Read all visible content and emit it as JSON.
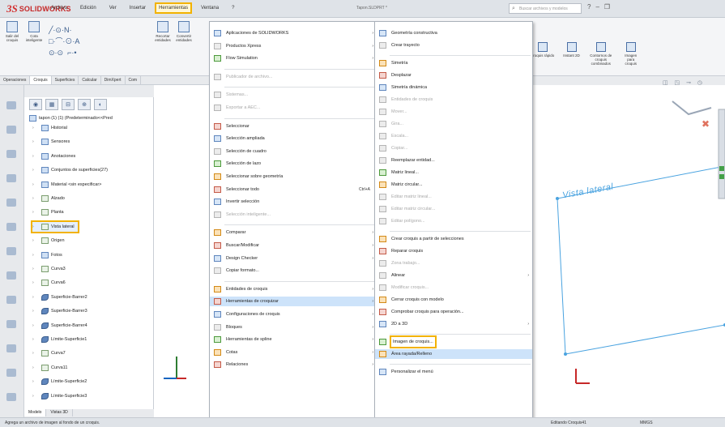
{
  "app": {
    "brand_ds": "3S",
    "brand_name": "SOLIDWORKS",
    "doc_title": "Tapon.SLDPRT *",
    "search_placeholder": "Buscar archivos y modelos"
  },
  "menubar": [
    "Archivo",
    "Edición",
    "Ver",
    "Insertar",
    "Herramientas",
    "Ventana",
    "?"
  ],
  "ribbon": {
    "left_buttons": [
      "Salir del croquis",
      "Cota inteligente",
      "Recortar entidades",
      "Convertir entidades"
    ],
    "right_buttons": [
      "Croquis rápido",
      "Instant 2D",
      "Contornos de croquis combinados",
      "Imagen para croquis"
    ]
  },
  "command_tabs": [
    "Operaciones",
    "Croquis",
    "Superficies",
    "Calcular",
    "DimXpert",
    "Com"
  ],
  "tree": {
    "root": "tapon (1) (1) (Predeterminado<<Pred",
    "items": [
      {
        "label": "Historial",
        "icon": "folder-icon",
        "indent": 1
      },
      {
        "label": "Sensores",
        "icon": "sensor-icon",
        "indent": 1
      },
      {
        "label": "Anotaciones",
        "icon": "annotation-icon",
        "indent": 1
      },
      {
        "label": "Conjuntos de superficies(27)",
        "icon": "surface-set-icon",
        "indent": 1
      },
      {
        "label": "Material <sin especificar>",
        "icon": "material-icon",
        "indent": 1
      },
      {
        "label": "Alzado",
        "icon": "plane-icon",
        "indent": 1
      },
      {
        "label": "Planta",
        "icon": "plane-icon",
        "indent": 1
      },
      {
        "label": "Vista lateral",
        "icon": "plane-icon",
        "indent": 1
      },
      {
        "label": "Origen",
        "icon": "origin-icon",
        "indent": 1
      },
      {
        "label": "Fotos",
        "icon": "folder-icon",
        "indent": 1
      },
      {
        "label": "Curva3",
        "icon": "curve-icon",
        "indent": 1
      },
      {
        "label": "Curva6",
        "icon": "curve-icon",
        "indent": 1
      },
      {
        "label": "Superficie-Barrer2",
        "icon": "surface-icon",
        "indent": 1
      },
      {
        "label": "Superficie-Barrer3",
        "icon": "surface-icon",
        "indent": 1
      },
      {
        "label": "Superficie-Barrer4",
        "icon": "surface-icon",
        "indent": 1
      },
      {
        "label": "Límite-Superficie1",
        "icon": "boundary-icon",
        "indent": 1
      },
      {
        "label": "Curva7",
        "icon": "curve-icon",
        "indent": 1
      },
      {
        "label": "Curva11",
        "icon": "curve-icon",
        "indent": 1
      },
      {
        "label": "Límite-Superficie2",
        "icon": "boundary-icon",
        "indent": 1
      },
      {
        "label": "Límite-Superficie3",
        "icon": "boundary-icon",
        "indent": 1
      }
    ]
  },
  "bottom_tabs": [
    "Modelo",
    "Vistas 3D"
  ],
  "status": {
    "left": "Agrega un archivo de imagen al fondo de un croquis.",
    "editing": "Editando Croquis41",
    "units": "MMGS"
  },
  "viewport": {
    "plane_label": "Vista lateral"
  },
  "menu_tools": [
    {
      "label": "Aplicaciones de SOLIDWORKS",
      "arrow": true
    },
    {
      "label": "Productos Xpress",
      "arrow": true
    },
    {
      "label": "Flow Simulation",
      "arrow": true
    },
    {
      "sep": true
    },
    {
      "label": "Publicador de archivo...",
      "disabled": true
    },
    {
      "sep": true
    },
    {
      "label": "Sistemas...",
      "disabled": true
    },
    {
      "label": "Exportar a AEC...",
      "disabled": true
    },
    {
      "sep": true
    },
    {
      "label": "Seleccionar"
    },
    {
      "label": "Selección ampliada"
    },
    {
      "label": "Selección de cuadro"
    },
    {
      "label": "Selección de lazo"
    },
    {
      "label": "Seleccionar sobre geometría"
    },
    {
      "label": "Seleccionar todo",
      "shortcut": "Ctrl+A"
    },
    {
      "label": "Invertir selección"
    },
    {
      "label": "Selección inteligente...",
      "disabled": true
    },
    {
      "sep": true
    },
    {
      "label": "Comparar",
      "arrow": true
    },
    {
      "label": "Buscar/Modificar",
      "arrow": true
    },
    {
      "label": "Design Checker",
      "arrow": true
    },
    {
      "label": "Copiar formato..."
    },
    {
      "sep": true
    },
    {
      "label": "Entidades de croquis",
      "arrow": true
    },
    {
      "label": "Herramientas de croquizar",
      "arrow": true,
      "selected": true
    },
    {
      "label": "Configuraciones de croquis",
      "arrow": true
    },
    {
      "label": "Bloques",
      "arrow": true
    },
    {
      "label": "Herramientas de spline",
      "arrow": true
    },
    {
      "label": "Cotas",
      "arrow": true
    },
    {
      "label": "Relaciones",
      "arrow": true
    }
  ],
  "menu_sketch_tools": [
    {
      "label": "Geometría constructiva"
    },
    {
      "label": "Crear trayecto"
    },
    {
      "sep": true
    },
    {
      "label": "Simetría"
    },
    {
      "label": "Desplazar"
    },
    {
      "label": "Simetría dinámica"
    },
    {
      "label": "Entidades de croquis",
      "disabled": true
    },
    {
      "label": "Mover...",
      "disabled": true
    },
    {
      "label": "Gira...",
      "disabled": true
    },
    {
      "label": "Escala...",
      "disabled": true
    },
    {
      "label": "Copiar...",
      "disabled": true
    },
    {
      "label": "Reemplazar entidad..."
    },
    {
      "label": "Matriz lineal..."
    },
    {
      "label": "Matriz circular..."
    },
    {
      "label": "Editar matriz lineal...",
      "disabled": true
    },
    {
      "label": "Editar matriz circular...",
      "disabled": true
    },
    {
      "label": "Editar polígono...",
      "disabled": true
    },
    {
      "sep": true
    },
    {
      "label": "Crear croquis a partir de selecciones"
    },
    {
      "label": "Reparar croquis"
    },
    {
      "label": "Zona trabajo...",
      "disabled": true
    },
    {
      "label": "Alinear",
      "arrow": true
    },
    {
      "label": "Modificar croquis...",
      "disabled": true
    },
    {
      "label": "Cerrar croquis con modelo"
    },
    {
      "label": "Comprobar croquis para operación..."
    },
    {
      "label": "2D a 3D",
      "arrow": true
    },
    {
      "sep": true
    },
    {
      "label": "Imagen de croquis...",
      "boxed": true
    },
    {
      "label": "Área rayada/Relleno",
      "selected": true
    },
    {
      "sep": true
    },
    {
      "label": "Personalizar el menú"
    }
  ]
}
